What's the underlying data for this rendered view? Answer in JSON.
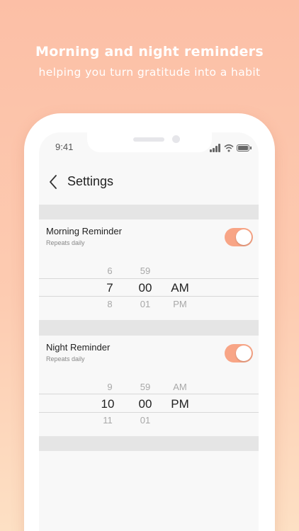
{
  "promo": {
    "headline": "Morning and night reminders",
    "subline": "helping you turn gratitude into a habit"
  },
  "status_bar": {
    "time": "9:41",
    "icons": [
      "signal-icon",
      "wifi-icon",
      "battery-icon"
    ]
  },
  "nav": {
    "back_icon": "chevron-left-icon",
    "title": "Settings"
  },
  "reminders": [
    {
      "title": "Morning Reminder",
      "subtitle": "Repeats daily",
      "enabled": true,
      "picker": {
        "hour": {
          "above": "6",
          "selected": "7",
          "below": "8"
        },
        "minute": {
          "above": "59",
          "selected": "00",
          "below": "01"
        },
        "period": {
          "above": "",
          "selected": "AM",
          "below": "PM"
        }
      }
    },
    {
      "title": "Night Reminder",
      "subtitle": "Repeats daily",
      "enabled": true,
      "picker": {
        "hour": {
          "above": "9",
          "selected": "10",
          "below": "11"
        },
        "minute": {
          "above": "59",
          "selected": "00",
          "below": "01"
        },
        "period": {
          "above": "AM",
          "selected": "PM",
          "below": ""
        }
      }
    }
  ],
  "colors": {
    "accent": "#f8a586",
    "background_top": "#fcbfa6",
    "background_bottom": "#fde0c4"
  }
}
